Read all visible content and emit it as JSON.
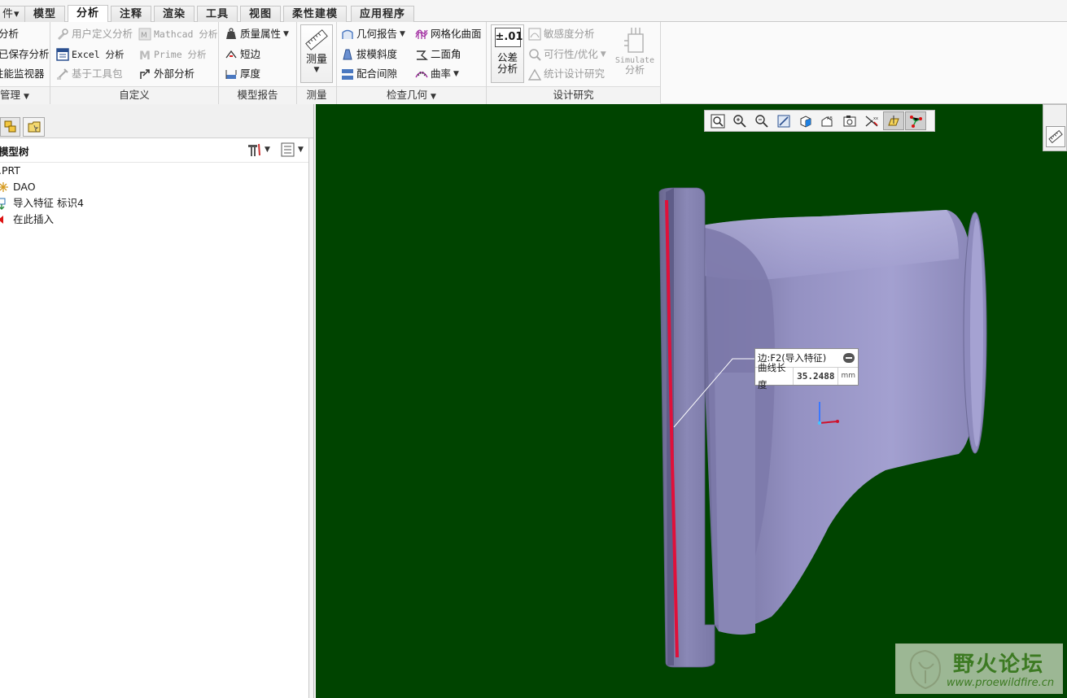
{
  "tabs": {
    "file": "件▾",
    "items": [
      "模型",
      "分析",
      "注释",
      "渲染",
      "工具",
      "视图",
      "柔性建模",
      "应用程序"
    ],
    "active": "分析"
  },
  "ribbon": {
    "manage": {
      "items": [
        "分析",
        "已保存分析",
        "性能监视器"
      ],
      "label": "管理"
    },
    "custom": {
      "items": [
        "用户定义分析",
        "Excel 分析",
        "基于工具包",
        "Mathcad 分析",
        "Prime 分析",
        "外部分析"
      ],
      "label": "自定义"
    },
    "model_report": {
      "items": [
        "质量属性",
        "短边",
        "厚度"
      ],
      "label": "模型报告"
    },
    "measure": {
      "button": "测量",
      "label": "测量"
    },
    "inspect": {
      "items": [
        "几何报告",
        "拔模斜度",
        "配合间隙",
        "网格化曲面",
        "二面角",
        "曲率"
      ],
      "label": "检查几何"
    },
    "design": {
      "tolerance_value": "±.01",
      "tolerance_label": "公差分析",
      "items": [
        "敏感度分析",
        "可行性/优化",
        "统计设计研究"
      ],
      "simulate_label_1": "Simulate",
      "simulate_label_2": "分析",
      "label": "设计研究"
    }
  },
  "model_tree": {
    "title": "模型树",
    "items": [
      ".PRT",
      "DAO",
      "导入特征 标识4",
      "在此插入"
    ]
  },
  "viewport": {
    "background": "#004400",
    "tooltip": {
      "edge": "边:F2(导入特征)",
      "label": "曲线长度",
      "value": "35.2488",
      "unit": "mm"
    }
  },
  "watermark": {
    "title": "野火论坛",
    "url": "www.proewildfire.cn"
  }
}
